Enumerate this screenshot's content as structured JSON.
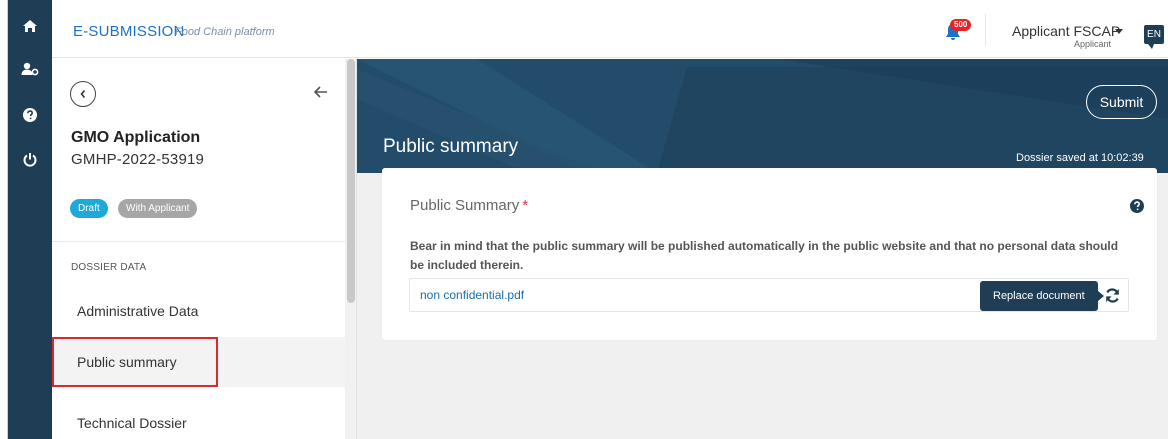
{
  "header": {
    "brand": "E-SUBMISSION",
    "brand_sub": "Food Chain platform",
    "notification_count": "500",
    "user_name": "Applicant FSCAP",
    "user_role": "Applicant",
    "language": "EN"
  },
  "rail": {
    "items": [
      {
        "icon": "home-icon"
      },
      {
        "icon": "user-settings-icon"
      },
      {
        "icon": "help-icon"
      },
      {
        "icon": "power-icon"
      }
    ]
  },
  "sidebar": {
    "app_title": "GMO Application",
    "app_id": "GMHP-2022-53919",
    "badges": [
      "Draft",
      "With Applicant"
    ],
    "section_label": "DOSSIER DATA",
    "items": [
      {
        "label": "Administrative Data"
      },
      {
        "label": "Public summary",
        "selected": true
      },
      {
        "label": "Technical Dossier"
      }
    ]
  },
  "main": {
    "page_title": "Public summary",
    "submit_label": "Submit",
    "saved_text": "Dossier saved at 10:02:39",
    "field_label": "Public Summary",
    "required_mark": "*",
    "notice": "Bear in mind that the public summary will be published automatically in the public website and that no personal data should be included therein.",
    "file_name": "non confidential.pdf",
    "tooltip": "Replace document"
  },
  "colors": {
    "rail": "#1f3e56",
    "banner": "#1f4561",
    "brand": "#1b73c4",
    "badge_draft": "#1fa9d8",
    "badge_applicant": "#a6a6a6",
    "selection_outline": "#d72a2a"
  }
}
